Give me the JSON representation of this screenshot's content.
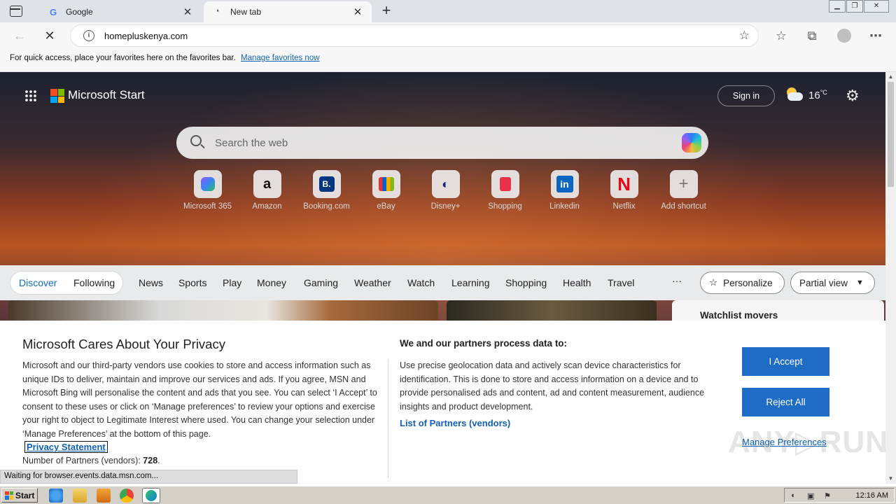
{
  "tabs": [
    {
      "title": "Google",
      "favicon": "google-icon",
      "active": false
    },
    {
      "title": "New tab",
      "favicon": "loading-icon",
      "active": true
    }
  ],
  "address": {
    "url": "homepluskenya.com"
  },
  "favorites_bar": {
    "text": "For quick access, place your favorites here on the favorites bar.",
    "link": "Manage favorites now"
  },
  "start": {
    "brand": "Microsoft Start",
    "sign_in": "Sign in",
    "temperature": "16",
    "temp_unit": "°C",
    "search_placeholder": "Search the web",
    "shortcuts": [
      {
        "label": "Microsoft 365",
        "icon": "m365-icon"
      },
      {
        "label": "Amazon",
        "icon": "amazon-icon"
      },
      {
        "label": "Booking.com",
        "icon": "booking-icon"
      },
      {
        "label": "eBay",
        "icon": "ebay-icon"
      },
      {
        "label": "Disney+",
        "icon": "disney-icon"
      },
      {
        "label": "Shopping",
        "icon": "shopping-icon"
      },
      {
        "label": "Linkedin",
        "icon": "linkedin-icon"
      },
      {
        "label": "Netflix",
        "icon": "netflix-icon"
      },
      {
        "label": "Add shortcut",
        "icon": "plus-icon"
      }
    ]
  },
  "feed_nav": {
    "tabs": [
      "Discover",
      "Following"
    ],
    "items": [
      "News",
      "Sports",
      "Play",
      "Money",
      "Gaming",
      "Weather",
      "Watch",
      "Learning",
      "Shopping",
      "Health",
      "Travel"
    ],
    "more": "···",
    "personalize": "Personalize",
    "view": "Partial view",
    "watchlist": "Watchlist movers"
  },
  "consent": {
    "title": "Microsoft Cares About Your Privacy",
    "body": "Microsoft and our third-party vendors use cookies to store and access information such as unique IDs to deliver, maintain and improve our services and ads. If you agree, MSN and Microsoft Bing will personalise the content and ads that you see. You can select ‘I Accept’ to consent to these uses or click on ‘Manage preferences’ to review your options and exercise your right to object to Legitimate Interest where used.  You can change your selection under ‘Manage Preferences’ at the bottom of this page.",
    "privacy_link": "Privacy Statement",
    "partners_label": "Number of Partners (vendors):",
    "partners_count": "728",
    "partners_suffix": ".",
    "right_title": "We and our partners process data to:",
    "right_body": "Use precise geolocation data and actively scan device characteristics for identification. This is done to store and access information on a device and to provide personalised ads and content, ad and content measurement, audience insights and product development.",
    "vendors_link": "List of Partners (vendors)",
    "accept": "I Accept",
    "reject": "Reject All",
    "manage": "Manage Preferences"
  },
  "status_text": "Waiting for browser.events.data.msn.com...",
  "taskbar": {
    "start": "Start",
    "clock": "12:16 AM"
  },
  "colors": {
    "accent": "#1f6cc7",
    "link": "#0f5fb8",
    "discover": "#0f6cbd"
  }
}
